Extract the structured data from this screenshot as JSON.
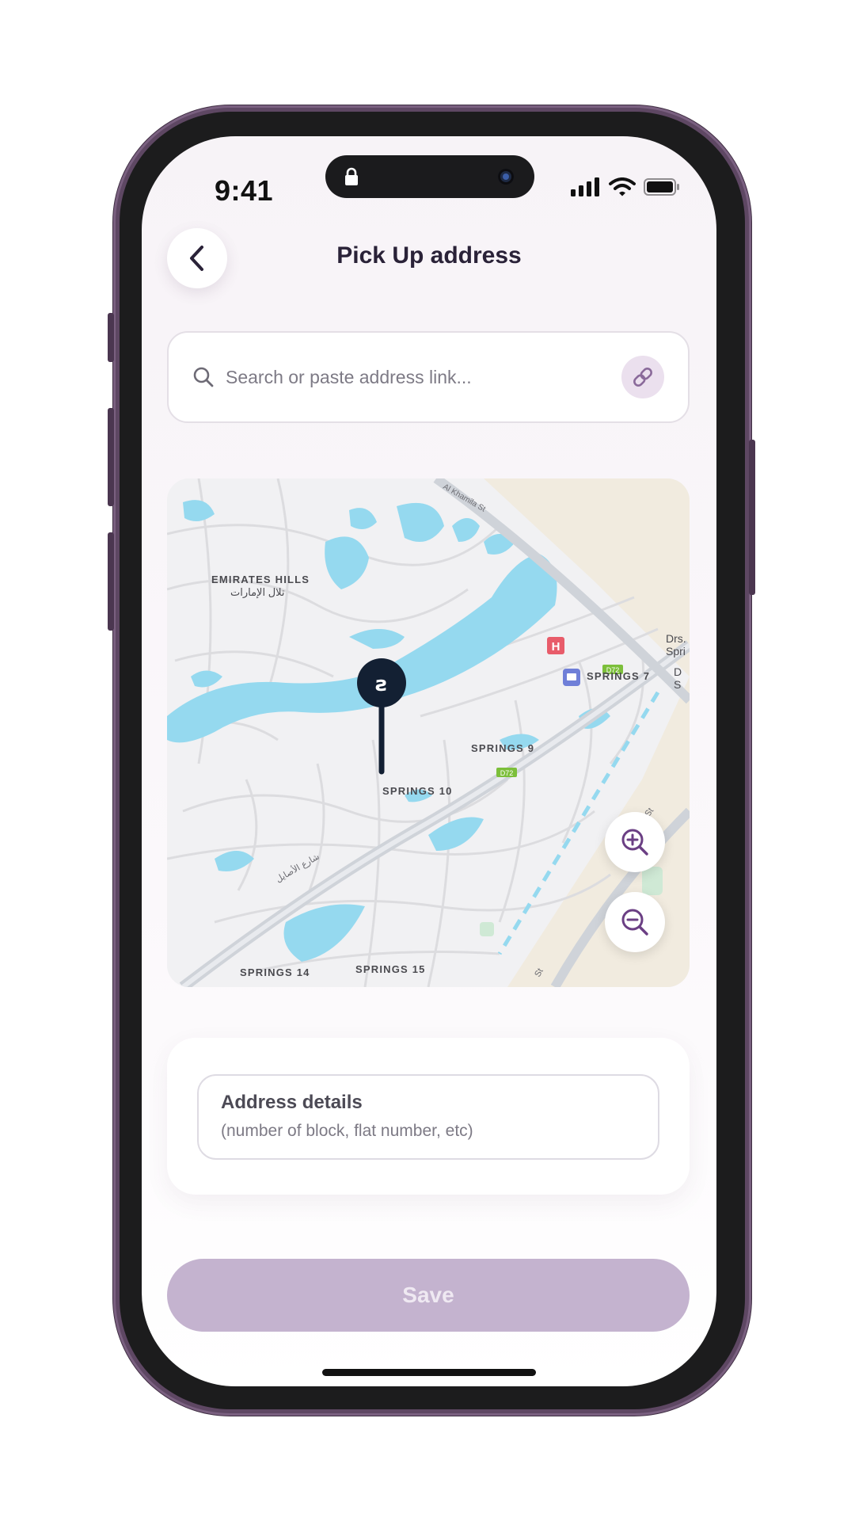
{
  "status_bar": {
    "time": "9:41"
  },
  "header": {
    "title": "Pick Up address"
  },
  "search": {
    "placeholder": "Search or paste address link..."
  },
  "map": {
    "labels": {
      "emirates_hills": "EMIRATES HILLS",
      "emirates_hills_ar": "تلال الإمارات",
      "springs_7": "SPRINGS 7",
      "springs_9": "SPRINGS 9",
      "springs_10": "SPRINGS 10",
      "springs_14": "SPRINGS 14",
      "springs_15": "SPRINGS 15",
      "drs_top": "Drs.",
      "drs_sub": "Spri",
      "d_top": "D",
      "d_sub": "S",
      "road_badge": "D72",
      "road_badge_2": "D72",
      "khamila": "Al Khamila St",
      "st_right": "nd St",
      "st_bottom": "St",
      "ar_road": "شارع الأصايل",
      "hospital_letter": "H"
    },
    "pin_glyph": "ƨ"
  },
  "address_details": {
    "title": "Address details",
    "subtitle": "(number of block, flat number, etc)"
  },
  "actions": {
    "save_label": "Save"
  },
  "colors": {
    "primary": "#2a2238",
    "accent": "#6b3f84",
    "water": "#95d9ef",
    "save_disabled": "#c4b3cf"
  }
}
